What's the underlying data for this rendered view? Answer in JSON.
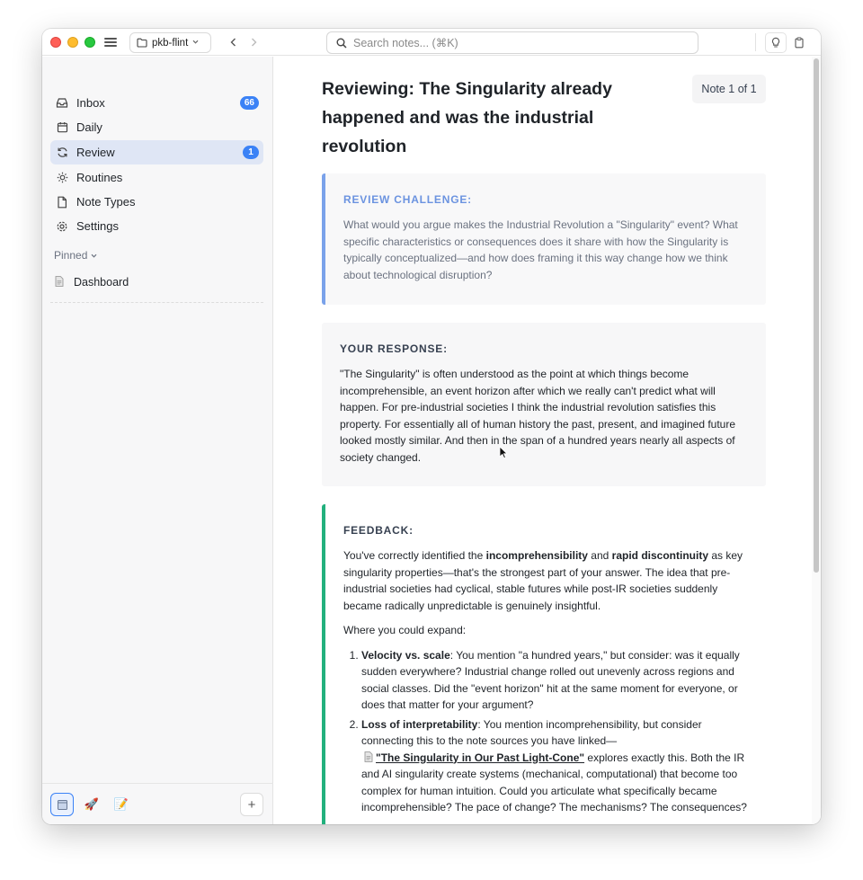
{
  "titlebar": {
    "vault_name": "pkb-flint",
    "search_placeholder": "Search notes... (⌘K)"
  },
  "sidebar": {
    "items": [
      {
        "label": "Inbox",
        "badge": "66"
      },
      {
        "label": "Daily"
      },
      {
        "label": "Review",
        "badge": "1"
      },
      {
        "label": "Routines"
      },
      {
        "label": "Note Types"
      },
      {
        "label": "Settings"
      }
    ],
    "pinned_label": "Pinned",
    "pinned_items": [
      {
        "label": "Dashboard"
      }
    ]
  },
  "main": {
    "title": "Reviewing: The Singularity already happened and was the industrial revolution",
    "counter": "Note 1 of 1",
    "challenge": {
      "heading": "REVIEW CHALLENGE:",
      "body": "What would you argue makes the Industrial Revolution a \"Singularity\" event? What specific characteristics or consequences does it share with how the Singularity is typically conceptualized—and how does framing it this way change how we think about technological disruption?"
    },
    "response": {
      "heading": "YOUR RESPONSE:",
      "body": "\"The Singularity\" is often understood as the point at which things become incomprehensible, an event horizon after which we really can't predict what will happen. For pre-industrial societies I think the industrial revolution satisfies this property. For essentially all of human history the past, present, and imagined future looked mostly similar. And then in the span of a hundred years nearly all aspects of society changed."
    },
    "feedback": {
      "heading": "FEEDBACK:",
      "p1_a": "You've correctly identified the ",
      "p1_b": "incomprehensibility",
      "p1_c": " and ",
      "p1_d": "rapid discontinuity",
      "p1_e": " as key singularity properties—that's the strongest part of your answer. The idea that pre-industrial societies had cyclical, stable futures while post-IR societies suddenly became radically unpredictable is genuinely insightful.",
      "p2": "Where you could expand:",
      "items": [
        {
          "title": "Velocity vs. scale",
          "text": ": You mention \"a hundred years,\" but consider: was it equally sudden everywhere? Industrial change rolled out unevenly across regions and social classes. Did the \"event horizon\" hit at the same moment for everyone, or does that matter for your argument?"
        },
        {
          "title": "Loss of interpretability",
          "text_a": ": You mention incomprehensibility, but consider connecting this to the note sources you have linked—",
          "link": "\"The Singularity in Our Past Light-Cone\"",
          "text_b": " explores exactly this. Both the IR and AI singularity create systems (mechanical, computational) that become too complex for human intuition. Could you articulate what specifically became incomprehensible? The pace of change? The mechanisms? The consequences?"
        }
      ]
    }
  }
}
